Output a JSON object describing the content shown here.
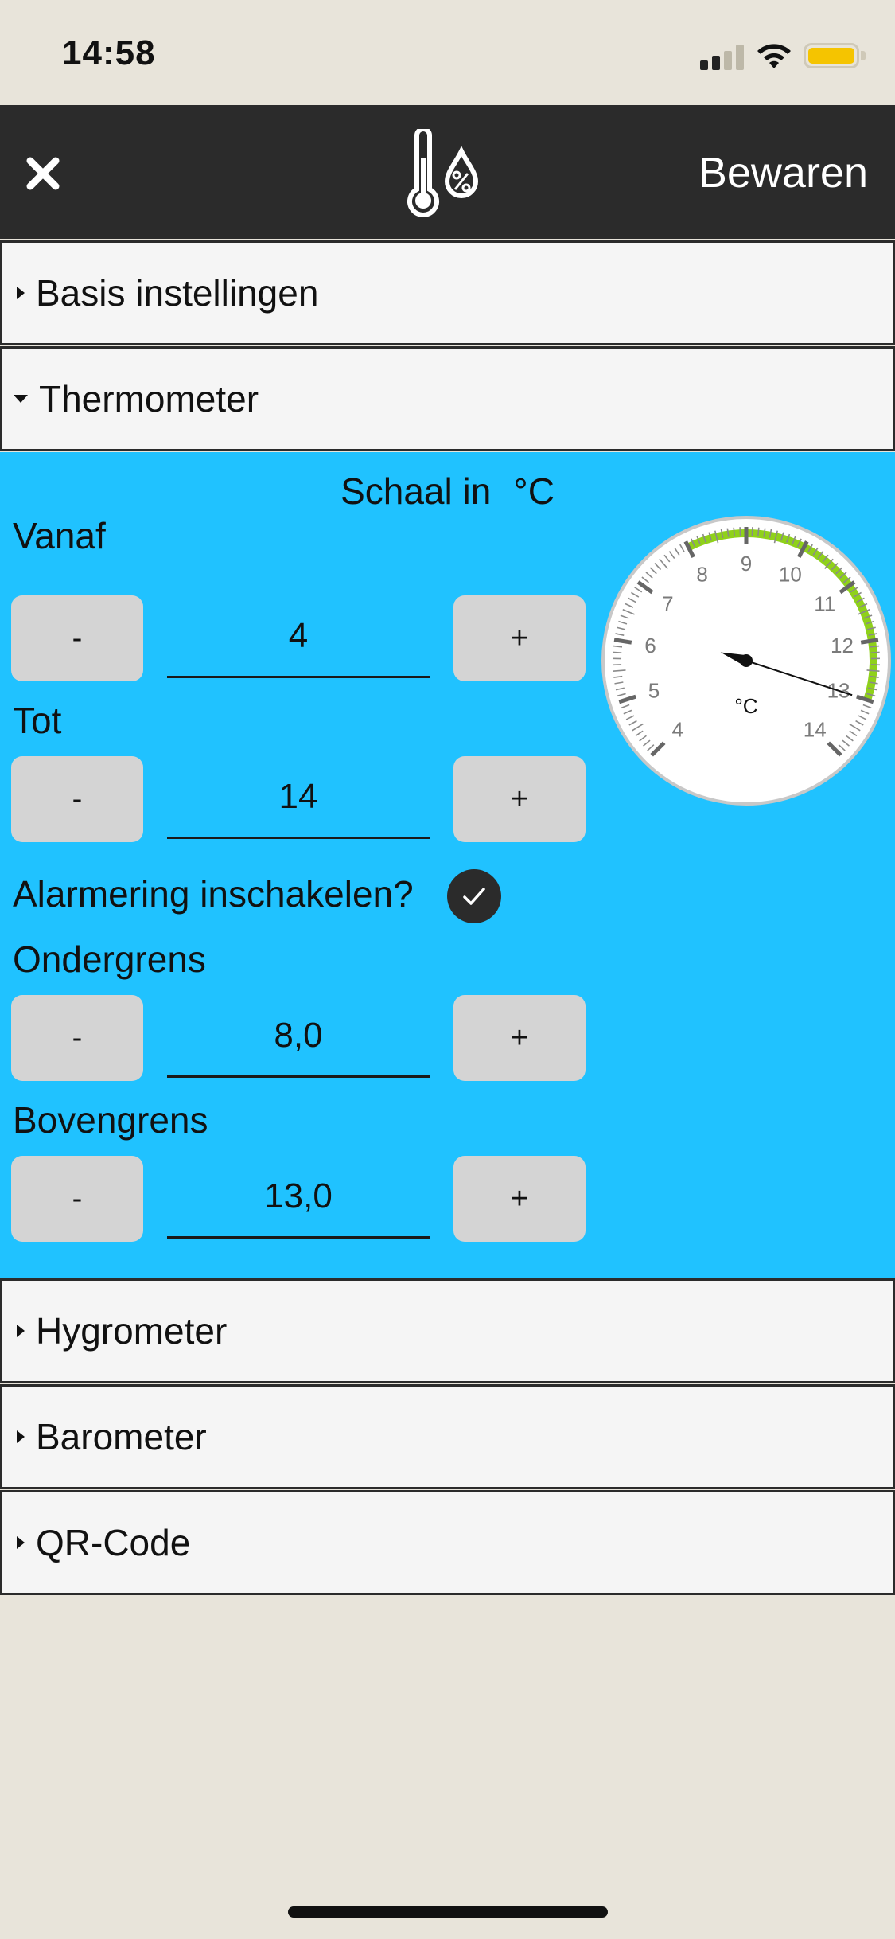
{
  "status": {
    "time": "14:58"
  },
  "nav": {
    "save_label": "Bewaren"
  },
  "sections": [
    {
      "label": "Basis instellingen",
      "expanded": false
    },
    {
      "label": "Thermometer",
      "expanded": true
    },
    {
      "label": "Hygrometer",
      "expanded": false
    },
    {
      "label": "Barometer",
      "expanded": false
    },
    {
      "label": "QR-Code",
      "expanded": false
    }
  ],
  "thermometer": {
    "scale_label": "Schaal in",
    "scale_unit": "°C",
    "from": {
      "label": "Vanaf",
      "value": "4",
      "minus": "-",
      "plus": "+"
    },
    "to": {
      "label": "Tot",
      "value": "14",
      "minus": "-",
      "plus": "+"
    },
    "alarm": {
      "label": "Alarmering inschakelen?",
      "checked": true
    },
    "lower": {
      "label": "Ondergrens",
      "value": "8,0",
      "minus": "-",
      "plus": "+"
    },
    "upper": {
      "label": "Bovengrens",
      "value": "13,0",
      "minus": "-",
      "plus": "+"
    },
    "gauge": {
      "unit": "°C",
      "ticks": [
        "4",
        "5",
        "6",
        "7",
        "8",
        "9",
        "10",
        "11",
        "12",
        "13",
        "14"
      ],
      "min": 4,
      "max": 14,
      "alarm_low": 8,
      "alarm_high": 13,
      "needle_value": 13,
      "alarm_color": "#8fd11a"
    }
  },
  "colors": {
    "panel": "#20c2ff",
    "navbar": "#2b2b2b",
    "background": "#e8e4da"
  }
}
